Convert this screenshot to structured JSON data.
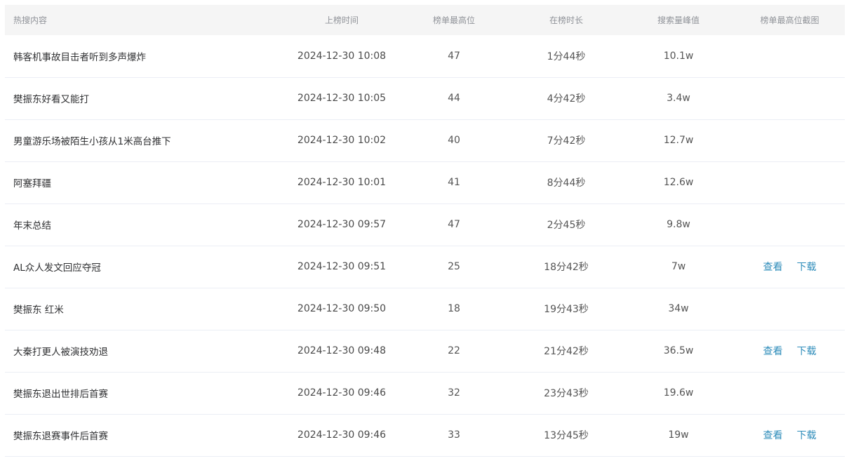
{
  "columns": [
    "热搜内容",
    "上榜时间",
    "榜单最高位",
    "在榜时长",
    "搜索量峰值",
    "榜单最高位截图"
  ],
  "link_color": "#2d8cba",
  "header_bg": "#f5f5f5",
  "rows": [
    {
      "title": "韩客机事故目击者听到多声爆炸",
      "time": "2024-12-30 10:08",
      "rank": "47",
      "duration": "1分44秒",
      "peak": "10.1w",
      "view": "",
      "download": ""
    },
    {
      "title": "樊振东好看又能打",
      "time": "2024-12-30 10:05",
      "rank": "44",
      "duration": "4分42秒",
      "peak": "3.4w",
      "view": "",
      "download": ""
    },
    {
      "title": "男童游乐场被陌生小孩从1米高台推下",
      "time": "2024-12-30 10:02",
      "rank": "40",
      "duration": "7分42秒",
      "peak": "12.7w",
      "view": "",
      "download": ""
    },
    {
      "title": "阿塞拜疆",
      "time": "2024-12-30 10:01",
      "rank": "41",
      "duration": "8分44秒",
      "peak": "12.6w",
      "view": "",
      "download": ""
    },
    {
      "title": "年末总结",
      "time": "2024-12-30 09:57",
      "rank": "47",
      "duration": "2分45秒",
      "peak": "9.8w",
      "view": "",
      "download": ""
    },
    {
      "title": "AL众人发文回应夺冠",
      "time": "2024-12-30 09:51",
      "rank": "25",
      "duration": "18分42秒",
      "peak": "7w",
      "view": "查看",
      "download": "下载"
    },
    {
      "title": "樊振东 红米",
      "time": "2024-12-30 09:50",
      "rank": "18",
      "duration": "19分43秒",
      "peak": "34w",
      "view": "",
      "download": ""
    },
    {
      "title": "大秦打更人被演技劝退",
      "time": "2024-12-30 09:48",
      "rank": "22",
      "duration": "21分42秒",
      "peak": "36.5w",
      "view": "查看",
      "download": "下载"
    },
    {
      "title": "樊振东退出世排后首赛",
      "time": "2024-12-30 09:46",
      "rank": "32",
      "duration": "23分43秒",
      "peak": "19.6w",
      "view": "",
      "download": ""
    },
    {
      "title": "樊振东退赛事件后首赛",
      "time": "2024-12-30 09:46",
      "rank": "33",
      "duration": "13分45秒",
      "peak": "19w",
      "view": "查看",
      "download": "下载"
    }
  ]
}
